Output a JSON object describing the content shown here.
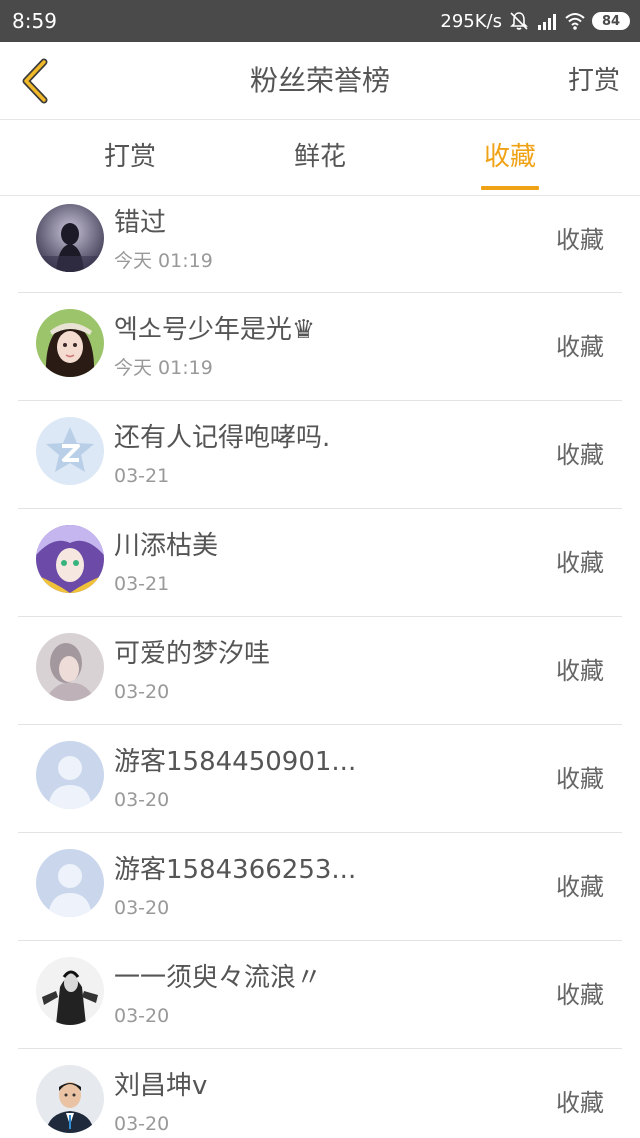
{
  "status_bar": {
    "time": "8:59",
    "network_speed": "295K/s",
    "battery": "84",
    "icons": [
      "mute-bell-icon",
      "signal-icon",
      "wifi-icon",
      "battery-icon"
    ]
  },
  "header": {
    "back_icon": "chevron-left-icon",
    "title": "粉丝荣誉榜",
    "action_label": "打赏"
  },
  "tabs": [
    {
      "label": "打赏",
      "active": false
    },
    {
      "label": "鲜花",
      "active": false
    },
    {
      "label": "收藏",
      "active": true
    }
  ],
  "colors": {
    "accent": "#f0a216",
    "text": "#555555",
    "subtext": "#999999",
    "status_bar": "#4a4a4a"
  },
  "list": [
    {
      "name": "错过",
      "time": "今天 01:19",
      "action": "收藏",
      "avatar": "dark-photo"
    },
    {
      "name": "엑소号少年是光♛",
      "time": "今天 01:19",
      "action": "收藏",
      "avatar": "girl-photo"
    },
    {
      "name": "还有人记得咆哮吗.",
      "time": "03-21",
      "action": "收藏",
      "avatar": "star-logo"
    },
    {
      "name": "川添枯美",
      "time": "03-21",
      "action": "收藏",
      "avatar": "anime"
    },
    {
      "name": "可爱的梦汐哇",
      "time": "03-20",
      "action": "收藏",
      "avatar": "blur-photo"
    },
    {
      "name": "游客1584450901...",
      "time": "03-20",
      "action": "收藏",
      "avatar": "default-user"
    },
    {
      "name": "游客1584366253...",
      "time": "03-20",
      "action": "收藏",
      "avatar": "default-user"
    },
    {
      "name": "一一须臾々流浪〃",
      "time": "03-20",
      "action": "收藏",
      "avatar": "sketch-photo"
    },
    {
      "name": "刘昌坤v",
      "time": "03-20",
      "action": "收藏",
      "avatar": "man-photo"
    }
  ]
}
